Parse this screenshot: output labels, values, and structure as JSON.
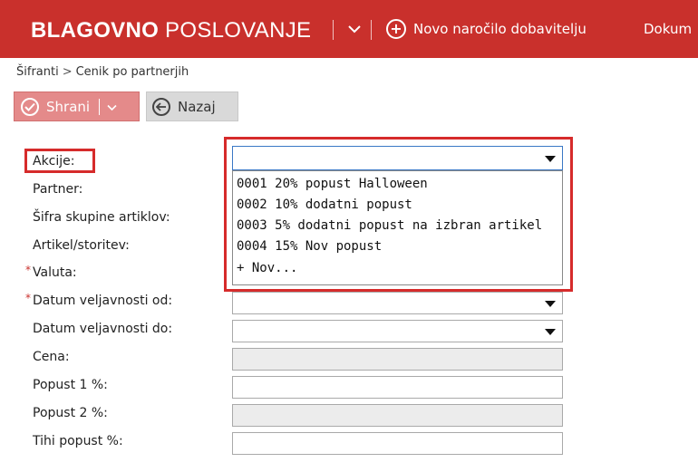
{
  "header": {
    "brand_bold": "BLAGOVNO",
    "brand_light": "POSLOVANJE",
    "new_order_label": "Novo naročilo dobavitelju",
    "docs_label": "Dokum"
  },
  "breadcrumb": {
    "root": "Šifranti",
    "separator": ">",
    "current": "Cenik po partnerjih"
  },
  "toolbar": {
    "save_label": "Shrani",
    "back_label": "Nazaj"
  },
  "form": {
    "fields": [
      {
        "label": "Akcije:",
        "required": false
      },
      {
        "label": "Partner:",
        "required": false
      },
      {
        "label": "Šifra skupine artiklov:",
        "required": false
      },
      {
        "label": "Artikel/storitev:",
        "required": false
      },
      {
        "label": "Valuta:",
        "required": true
      },
      {
        "label": "Datum veljavnosti od:",
        "required": true
      },
      {
        "label": "Datum veljavnosti do:",
        "required": false
      },
      {
        "label": "Cena:",
        "required": false
      },
      {
        "label": "Popust 1 %:",
        "required": false
      },
      {
        "label": "Popust 2 %:",
        "required": false
      },
      {
        "label": "Tihi popust %:",
        "required": false
      }
    ],
    "required_marker": "*",
    "akcije_options": [
      "0001  20% popust Halloween",
      "0002  10% dodatni popust",
      "0003  5% dodatni popust na izbran artikel",
      "0004  15% Nov popust",
      "+ Nov..."
    ]
  },
  "colors": {
    "header_bg": "#c9302c",
    "highlight": "#d62b2b",
    "save_button_bg": "#e48a8a",
    "focus_border": "#3a78c5"
  }
}
